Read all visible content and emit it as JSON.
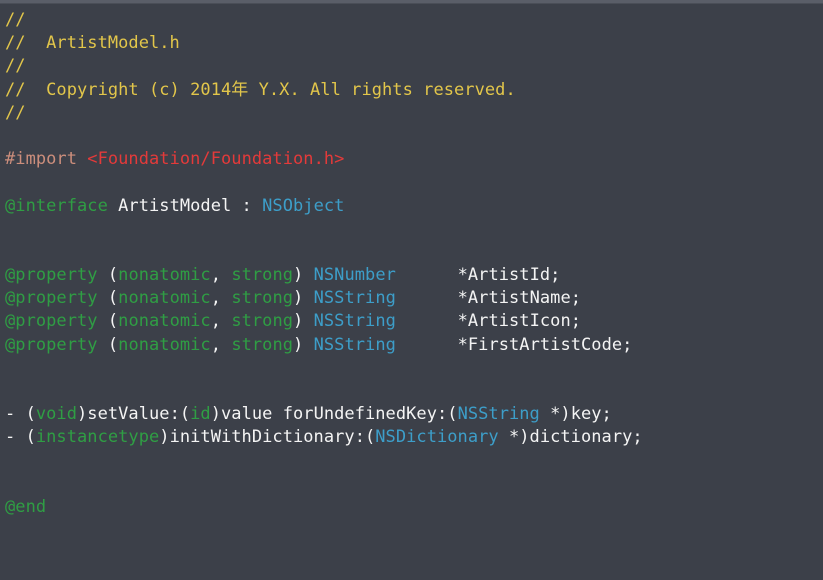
{
  "editor": {
    "name": "code-editor",
    "language": "objective-c",
    "background_color": "#3c4049",
    "top_strip_color": "#5a5e68",
    "colors": {
      "comment": "#e2c64a",
      "plain": "#f4f4f4",
      "preprocessor": "#cc8e7c",
      "string": "#e33a3a",
      "keyword": "#2f9e44",
      "type": "#3d9ec9"
    }
  },
  "lines": [
    {
      "n": 1,
      "text": "//"
    },
    {
      "n": 2,
      "text": "//  ArtistModel.h"
    },
    {
      "n": 3,
      "text": "//"
    },
    {
      "n": 4,
      "text": "//  Copyright (c) 2014年 Y.X. All rights reserved."
    },
    {
      "n": 5,
      "text": "//"
    },
    {
      "n": 6,
      "text": ""
    },
    {
      "n": 7,
      "text": "#import <Foundation/Foundation.h>"
    },
    {
      "n": 8,
      "text": ""
    },
    {
      "n": 9,
      "text": "@interface ArtistModel : NSObject"
    },
    {
      "n": 10,
      "text": ""
    },
    {
      "n": 11,
      "text": ""
    },
    {
      "n": 12,
      "text": "@property (nonatomic, strong) NSNumber      *ArtistId;"
    },
    {
      "n": 13,
      "text": "@property (nonatomic, strong) NSString      *ArtistName;"
    },
    {
      "n": 14,
      "text": "@property (nonatomic, strong) NSString      *ArtistIcon;"
    },
    {
      "n": 15,
      "text": "@property (nonatomic, strong) NSString      *FirstArtistCode;"
    },
    {
      "n": 16,
      "text": ""
    },
    {
      "n": 17,
      "text": ""
    },
    {
      "n": 18,
      "text": "- (void)setValue:(id)value forUndefinedKey:(NSString *)key;"
    },
    {
      "n": 19,
      "text": "- (instancetype)initWithDictionary:(NSDictionary *)dictionary;"
    },
    {
      "n": 20,
      "text": ""
    },
    {
      "n": 21,
      "text": ""
    },
    {
      "n": 22,
      "text": "@end"
    }
  ],
  "tokens": {
    "l1": [
      {
        "t": "//",
        "c": "comment"
      }
    ],
    "l2": [
      {
        "t": "//  ArtistModel.h",
        "c": "comment"
      }
    ],
    "l3": [
      {
        "t": "//",
        "c": "comment"
      }
    ],
    "l4": [
      {
        "t": "//  Copyright (c) 2014年 Y.X. All rights reserved.",
        "c": "comment"
      }
    ],
    "l5": [
      {
        "t": "//",
        "c": "comment"
      }
    ],
    "l7": [
      {
        "t": "#import",
        "c": "preproc"
      },
      {
        "t": " ",
        "c": "plain"
      },
      {
        "t": "<Foundation/Foundation.h>",
        "c": "string"
      }
    ],
    "l9": [
      {
        "t": "@interface",
        "c": "keyword"
      },
      {
        "t": " ArtistModel : ",
        "c": "plain"
      },
      {
        "t": "NSObject",
        "c": "type"
      }
    ],
    "l12": [
      {
        "t": "@property",
        "c": "keyword"
      },
      {
        "t": " (",
        "c": "plain"
      },
      {
        "t": "nonatomic",
        "c": "keyword"
      },
      {
        "t": ", ",
        "c": "plain"
      },
      {
        "t": "strong",
        "c": "keyword"
      },
      {
        "t": ") ",
        "c": "plain"
      },
      {
        "t": "NSNumber",
        "c": "type"
      },
      {
        "t": "      *ArtistId;",
        "c": "plain"
      }
    ],
    "l13": [
      {
        "t": "@property",
        "c": "keyword"
      },
      {
        "t": " (",
        "c": "plain"
      },
      {
        "t": "nonatomic",
        "c": "keyword"
      },
      {
        "t": ", ",
        "c": "plain"
      },
      {
        "t": "strong",
        "c": "keyword"
      },
      {
        "t": ") ",
        "c": "plain"
      },
      {
        "t": "NSString",
        "c": "type"
      },
      {
        "t": "      *ArtistName;",
        "c": "plain"
      }
    ],
    "l14": [
      {
        "t": "@property",
        "c": "keyword"
      },
      {
        "t": " (",
        "c": "plain"
      },
      {
        "t": "nonatomic",
        "c": "keyword"
      },
      {
        "t": ", ",
        "c": "plain"
      },
      {
        "t": "strong",
        "c": "keyword"
      },
      {
        "t": ") ",
        "c": "plain"
      },
      {
        "t": "NSString",
        "c": "type"
      },
      {
        "t": "      *ArtistIcon;",
        "c": "plain"
      }
    ],
    "l15": [
      {
        "t": "@property",
        "c": "keyword"
      },
      {
        "t": " (",
        "c": "plain"
      },
      {
        "t": "nonatomic",
        "c": "keyword"
      },
      {
        "t": ", ",
        "c": "plain"
      },
      {
        "t": "strong",
        "c": "keyword"
      },
      {
        "t": ") ",
        "c": "plain"
      },
      {
        "t": "NSString",
        "c": "type"
      },
      {
        "t": "      *FirstArtistCode;",
        "c": "plain"
      }
    ],
    "l18": [
      {
        "t": "- (",
        "c": "plain"
      },
      {
        "t": "void",
        "c": "keyword"
      },
      {
        "t": ")setValue:(",
        "c": "plain"
      },
      {
        "t": "id",
        "c": "keyword"
      },
      {
        "t": ")value forUndefinedKey:(",
        "c": "plain"
      },
      {
        "t": "NSString",
        "c": "type"
      },
      {
        "t": " *)key;",
        "c": "plain"
      }
    ],
    "l19": [
      {
        "t": "- (",
        "c": "plain"
      },
      {
        "t": "instancetype",
        "c": "keyword"
      },
      {
        "t": ")initWithDictionary:(",
        "c": "plain"
      },
      {
        "t": "NSDictionary",
        "c": "type"
      },
      {
        "t": " *)dictionary;",
        "c": "plain"
      }
    ],
    "l22": [
      {
        "t": "@end",
        "c": "keyword"
      }
    ]
  }
}
